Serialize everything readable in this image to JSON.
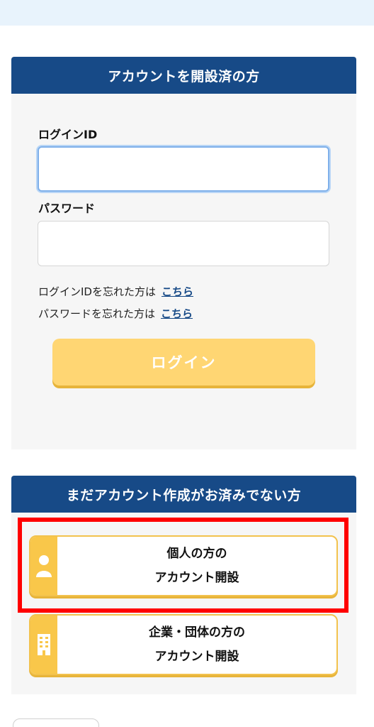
{
  "login_section": {
    "header": "アカウントを開設済の方",
    "login_id_label": "ログインID",
    "login_id_value": "",
    "password_label": "パスワード",
    "password_value": "",
    "forgot_id_text": "ログインIDを忘れた方は",
    "forgot_id_link": "こちら",
    "forgot_pw_text": "パスワードを忘れた方は",
    "forgot_pw_link": "こちら",
    "login_button": "ログイン"
  },
  "signup_section": {
    "header": "まだアカウント作成がお済みでない方",
    "personal": {
      "line1": "個人の方の",
      "line2": "アカウント開設",
      "icon": "person-icon"
    },
    "corporate": {
      "line1": "企業・団体の方の",
      "line2": "アカウント開設",
      "icon": "building-icon"
    }
  },
  "colors": {
    "header_bg": "#174a87",
    "accent_yellow": "#f9c74a",
    "login_button_bg": "#ffd673",
    "highlight_red": "#ff0000",
    "link_blue": "#174a87"
  }
}
